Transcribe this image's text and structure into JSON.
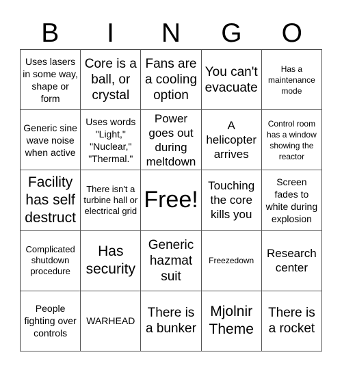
{
  "header": [
    "B",
    "I",
    "N",
    "G",
    "O"
  ],
  "cells": [
    {
      "text": "Uses lasers in some way, shape or form",
      "size": "s2"
    },
    {
      "text": "Core is a ball, or crystal",
      "size": "s4"
    },
    {
      "text": "Fans are a cooling option",
      "size": "s4"
    },
    {
      "text": "You can't evacuate",
      "size": "s4"
    },
    {
      "text": "Has a maintenance mode",
      "size": "s7"
    },
    {
      "text": "Generic sine wave noise when active",
      "size": "s2"
    },
    {
      "text": "Uses words \"Light,\" \"Nuclear,\" \"Thermal.\"",
      "size": "s2"
    },
    {
      "text": "Power goes out during meltdown",
      "size": "s3"
    },
    {
      "text": "A helicopter arrives",
      "size": "s3"
    },
    {
      "text": "Control room has a window showing the reactor",
      "size": "s7"
    },
    {
      "text": "Facility has self destruct",
      "size": "s5"
    },
    {
      "text": "There isn't a turbine hall or electrical grid",
      "size": "s1"
    },
    {
      "text": "Free!",
      "size": "s6"
    },
    {
      "text": "Touching the core kills you",
      "size": "s3"
    },
    {
      "text": "Screen fades to white during explosion",
      "size": "s2"
    },
    {
      "text": "Complicated shutdown procedure",
      "size": "s1"
    },
    {
      "text": "Has security",
      "size": "s5"
    },
    {
      "text": "Generic hazmat suit",
      "size": "s4"
    },
    {
      "text": "Freezedown",
      "size": "s7"
    },
    {
      "text": "Research center",
      "size": "s3"
    },
    {
      "text": "People fighting over controls",
      "size": "s2"
    },
    {
      "text": "WARHEAD",
      "size": "s2"
    },
    {
      "text": "There is a bunker",
      "size": "s4"
    },
    {
      "text": "Mjolnir Theme",
      "size": "s5"
    },
    {
      "text": "There is a rocket",
      "size": "s4"
    }
  ]
}
